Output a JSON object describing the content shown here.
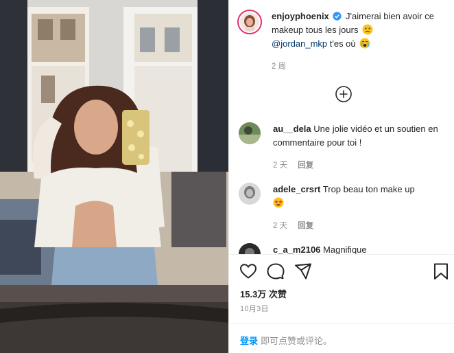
{
  "post": {
    "author": "enjoyphoenix",
    "caption_part1": "J'aimerai bien avoir ce makeup tous les jours",
    "caption_mention": "@jordan_mkp",
    "caption_part2": "t'es où",
    "caption_time": "2 周",
    "likes": "15.3万 次赞",
    "date": "10月3日"
  },
  "comments": [
    {
      "user": "au__dela",
      "text": "Une jolie vidéo et un soutien en commentaire pour toi !",
      "time": "2 天",
      "reply": "回复"
    },
    {
      "user": "adele_crsrt",
      "text": "Trop beau ton make up",
      "time": "2 天",
      "reply": "回复"
    },
    {
      "user": "c_a_m2106",
      "text": "Magnifique"
    }
  ],
  "login": {
    "link": "登录",
    "text": "即可点赞或评论。"
  },
  "colors": {
    "link": "#0095f6",
    "mention": "#00376b",
    "verified": "#3897f0",
    "muted": "#8e8e8e"
  },
  "icons": {
    "load_more": "plus-circle-icon",
    "like": "heart-icon",
    "comment": "comment-icon",
    "share": "share-icon",
    "save": "bookmark-icon"
  }
}
